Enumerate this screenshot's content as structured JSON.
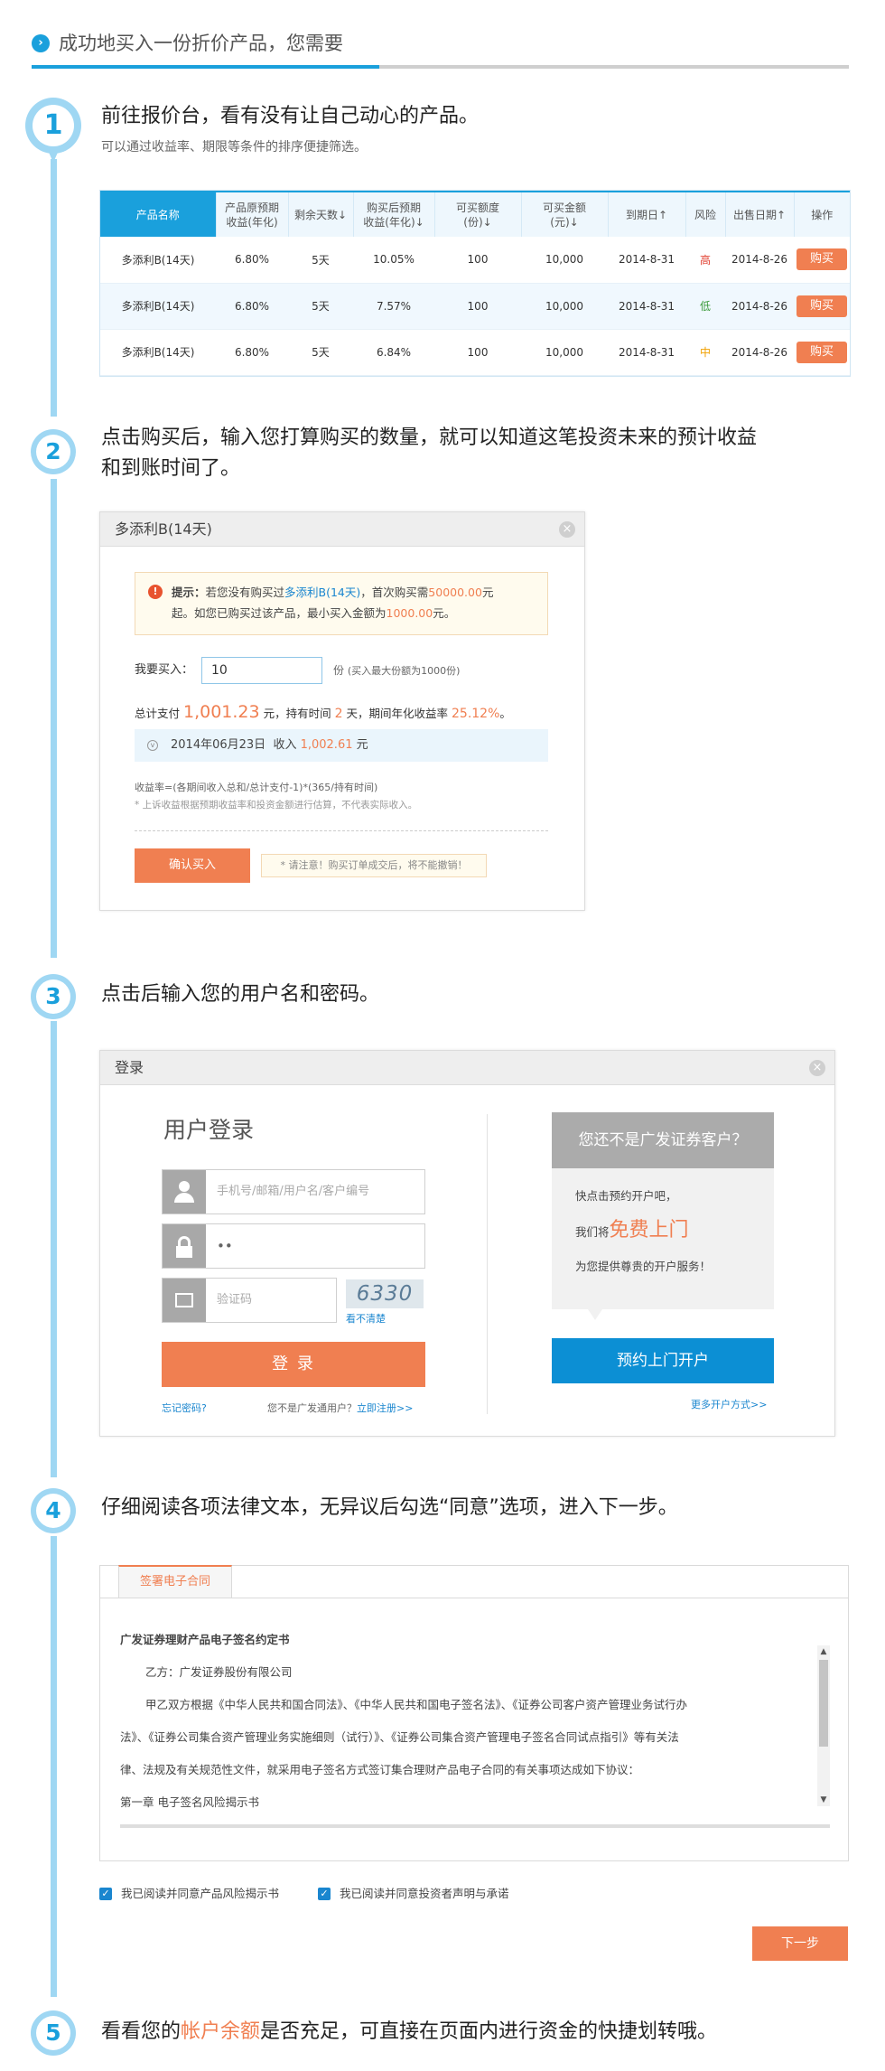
{
  "title": "成功地买入一份折价产品，您需要",
  "steps": [
    {
      "num": "1",
      "head": "前往报价台，看有没有让自己动心的产品。",
      "sub": "可以通过收益率、期限等条件的排序便捷筛选。"
    },
    {
      "num": "2",
      "head_line1": "点击购买后，输入您打算购买的数量，就可以知道这笔投资未来的预计收益",
      "head_line2": "和到账时间了。"
    },
    {
      "num": "3",
      "head": "点击后输入您的用户名和密码。"
    },
    {
      "num": "4",
      "head": "仔细阅读各项法律文本，无异议后勾选“同意”选项，进入下一步。"
    },
    {
      "num": "5",
      "head_pre": "看看您的",
      "head_hl": "帐户余额",
      "head_post": "是否充足，可直接在页面内进行资金的快捷划转哦。"
    }
  ],
  "table": {
    "headers": [
      "产品名称",
      "产品原预期\n收益(年化)",
      "剩余天数↓",
      "购买后预期\n收益(年化)↓",
      "可买额度\n(份)↓",
      "可买金额\n(元)↓",
      "到期日↑",
      "风险",
      "出售日期↑",
      "操作"
    ],
    "rows": [
      {
        "name": "多添利B(14天)",
        "orig": "6.80%",
        "days": "5天",
        "after": "10.05%",
        "quota": "100",
        "amount": "10,000",
        "due": "2014-8-31",
        "risk": "高",
        "sale": "2014-8-26",
        "op": "购买"
      },
      {
        "name": "多添利B(14天)",
        "orig": "6.80%",
        "days": "5天",
        "after": "7.57%",
        "quota": "100",
        "amount": "10,000",
        "due": "2014-8-31",
        "risk": "低",
        "sale": "2014-8-26",
        "op": "购买"
      },
      {
        "name": "多添利B(14天)",
        "orig": "6.80%",
        "days": "5天",
        "after": "6.84%",
        "quota": "100",
        "amount": "10,000",
        "due": "2014-8-31",
        "risk": "中",
        "sale": "2014-8-26",
        "op": "购买"
      }
    ],
    "risk_colors": [
      "#e03d2e",
      "#3a9a3a",
      "#f0a000"
    ]
  },
  "buy_dialog": {
    "title": "多添利B(14天)",
    "tip_label": "提示：",
    "tip_a": "若您没有购买过",
    "tip_product": "多添利B(14天)",
    "tip_b": "，首次购买需",
    "tip_first": "50000.00",
    "tip_c": "元",
    "tip_d": "起。如您已购买过该产品，最小买入金额为",
    "tip_min": "1000.00",
    "tip_e": "元。",
    "buy_label": "我要买入：",
    "buy_value": "10",
    "buy_unit": "份",
    "buy_note": "(买入最大份额为1000份)",
    "total_pre": "总计支付",
    "total_value": "1,001.23",
    "total_mid": "元，持有时间",
    "hold_days": "2",
    "hold_mid": "天，期间年化收益率",
    "yield": "25.12%",
    "yield_end": "。",
    "income_date": "2014年06月23日",
    "income_label": "收入",
    "income_value": "1,002.61",
    "income_unit": "元",
    "formula": "收益率=(各期间收入总和/总计支付-1)*(365/持有时间)",
    "disclaimer": "* 上诉收益根据预期收益率和投资金额进行估算，不代表实际收入。",
    "confirm_btn": "确认买入",
    "warn": "* 请注意！购买订单成交后，将不能撤销！"
  },
  "login_dialog": {
    "title": "登录",
    "heading": "用户登录",
    "user_placeholder": "手机号/邮箱/用户名/客户编号",
    "password_value": "••",
    "captcha_placeholder": "验证码",
    "captcha_text": "6330",
    "captcha_refresh": "看不清楚",
    "login_btn": "登 录",
    "forgot": "忘记密码?",
    "not_user": "您不是广发通用户？",
    "register": "立即注册>>",
    "promo_title": "您还不是广发证券客户？",
    "promo_line1": "快点击预约开户吧，",
    "promo_line2_pre": "我们将",
    "promo_line2_hl": "免费上门",
    "promo_line3": "为您提供尊贵的开户服务！",
    "book_btn": "预约上门开户",
    "more": "更多开户方式>>"
  },
  "contract": {
    "tab": "签署电子合同",
    "title": "广发证券理财产品电子签名约定书",
    "party_b": "乙方：广发证券股份有限公司",
    "para_1": "甲乙双方根据《中华人民共和国合同法》、《中华人民共和国电子签名法》、《证券公司客户资产管理业务试行办",
    "para_2": "法》、《证券公司集合资产管理业务实施细则（试行）》、《证券公司集合资产管理电子签名合同试点指引》等有关法",
    "para_3": "律、法规及有关规范性文件，就采用电子签名方式签订集合理财产品电子合同的有关事项达成如下协议：",
    "chapter": "第一章  电子签名风险揭示书",
    "agree1": "我已阅读并同意产品风险揭示书",
    "agree2": "我已阅读并同意投资者声明与承诺",
    "next_btn": "下一步"
  }
}
